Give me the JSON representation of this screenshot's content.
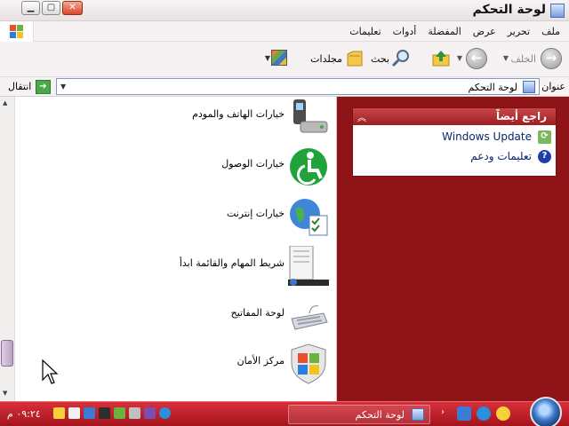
{
  "window": {
    "title": "لوحة التحكم"
  },
  "menu": {
    "items": [
      "ملف",
      "تحرير",
      "عرض",
      "المفضلة",
      "أدوات",
      "تعليمات"
    ]
  },
  "toolbar": {
    "back_label": "الخلف",
    "search_label": "بحث",
    "folders_label": "مجلدات"
  },
  "address": {
    "label": "عنوان",
    "value": "لوحة التحكم",
    "go_label": "انتقال"
  },
  "sidebar": {
    "see_also": {
      "title": "راجع أيضاً",
      "links": [
        {
          "label": "Windows Update",
          "icon": "windows-update-icon"
        },
        {
          "label": "تعليمات ودعم",
          "icon": "help-icon"
        }
      ]
    },
    "colors": {
      "background": "#8f1418"
    }
  },
  "items": [
    {
      "label": "خيارات الهاتف والمودم",
      "icon": "phone-modem-icon"
    },
    {
      "label": "خيارات الوصول",
      "icon": "accessibility-icon"
    },
    {
      "label": "خيارات إنترنت",
      "icon": "internet-options-icon"
    },
    {
      "label": "شريط المهام والقائمة ابدأ",
      "icon": "taskbar-start-menu-icon"
    },
    {
      "label": "لوحة المفاتيح",
      "icon": "keyboard-icon"
    },
    {
      "label": "مركز الأمان",
      "icon": "security-center-icon"
    }
  ],
  "taskbar": {
    "task_label": "لوحة التحكم",
    "clock": "٠٩:٢٤ م",
    "colors": {
      "bar": "#b91c24"
    }
  }
}
